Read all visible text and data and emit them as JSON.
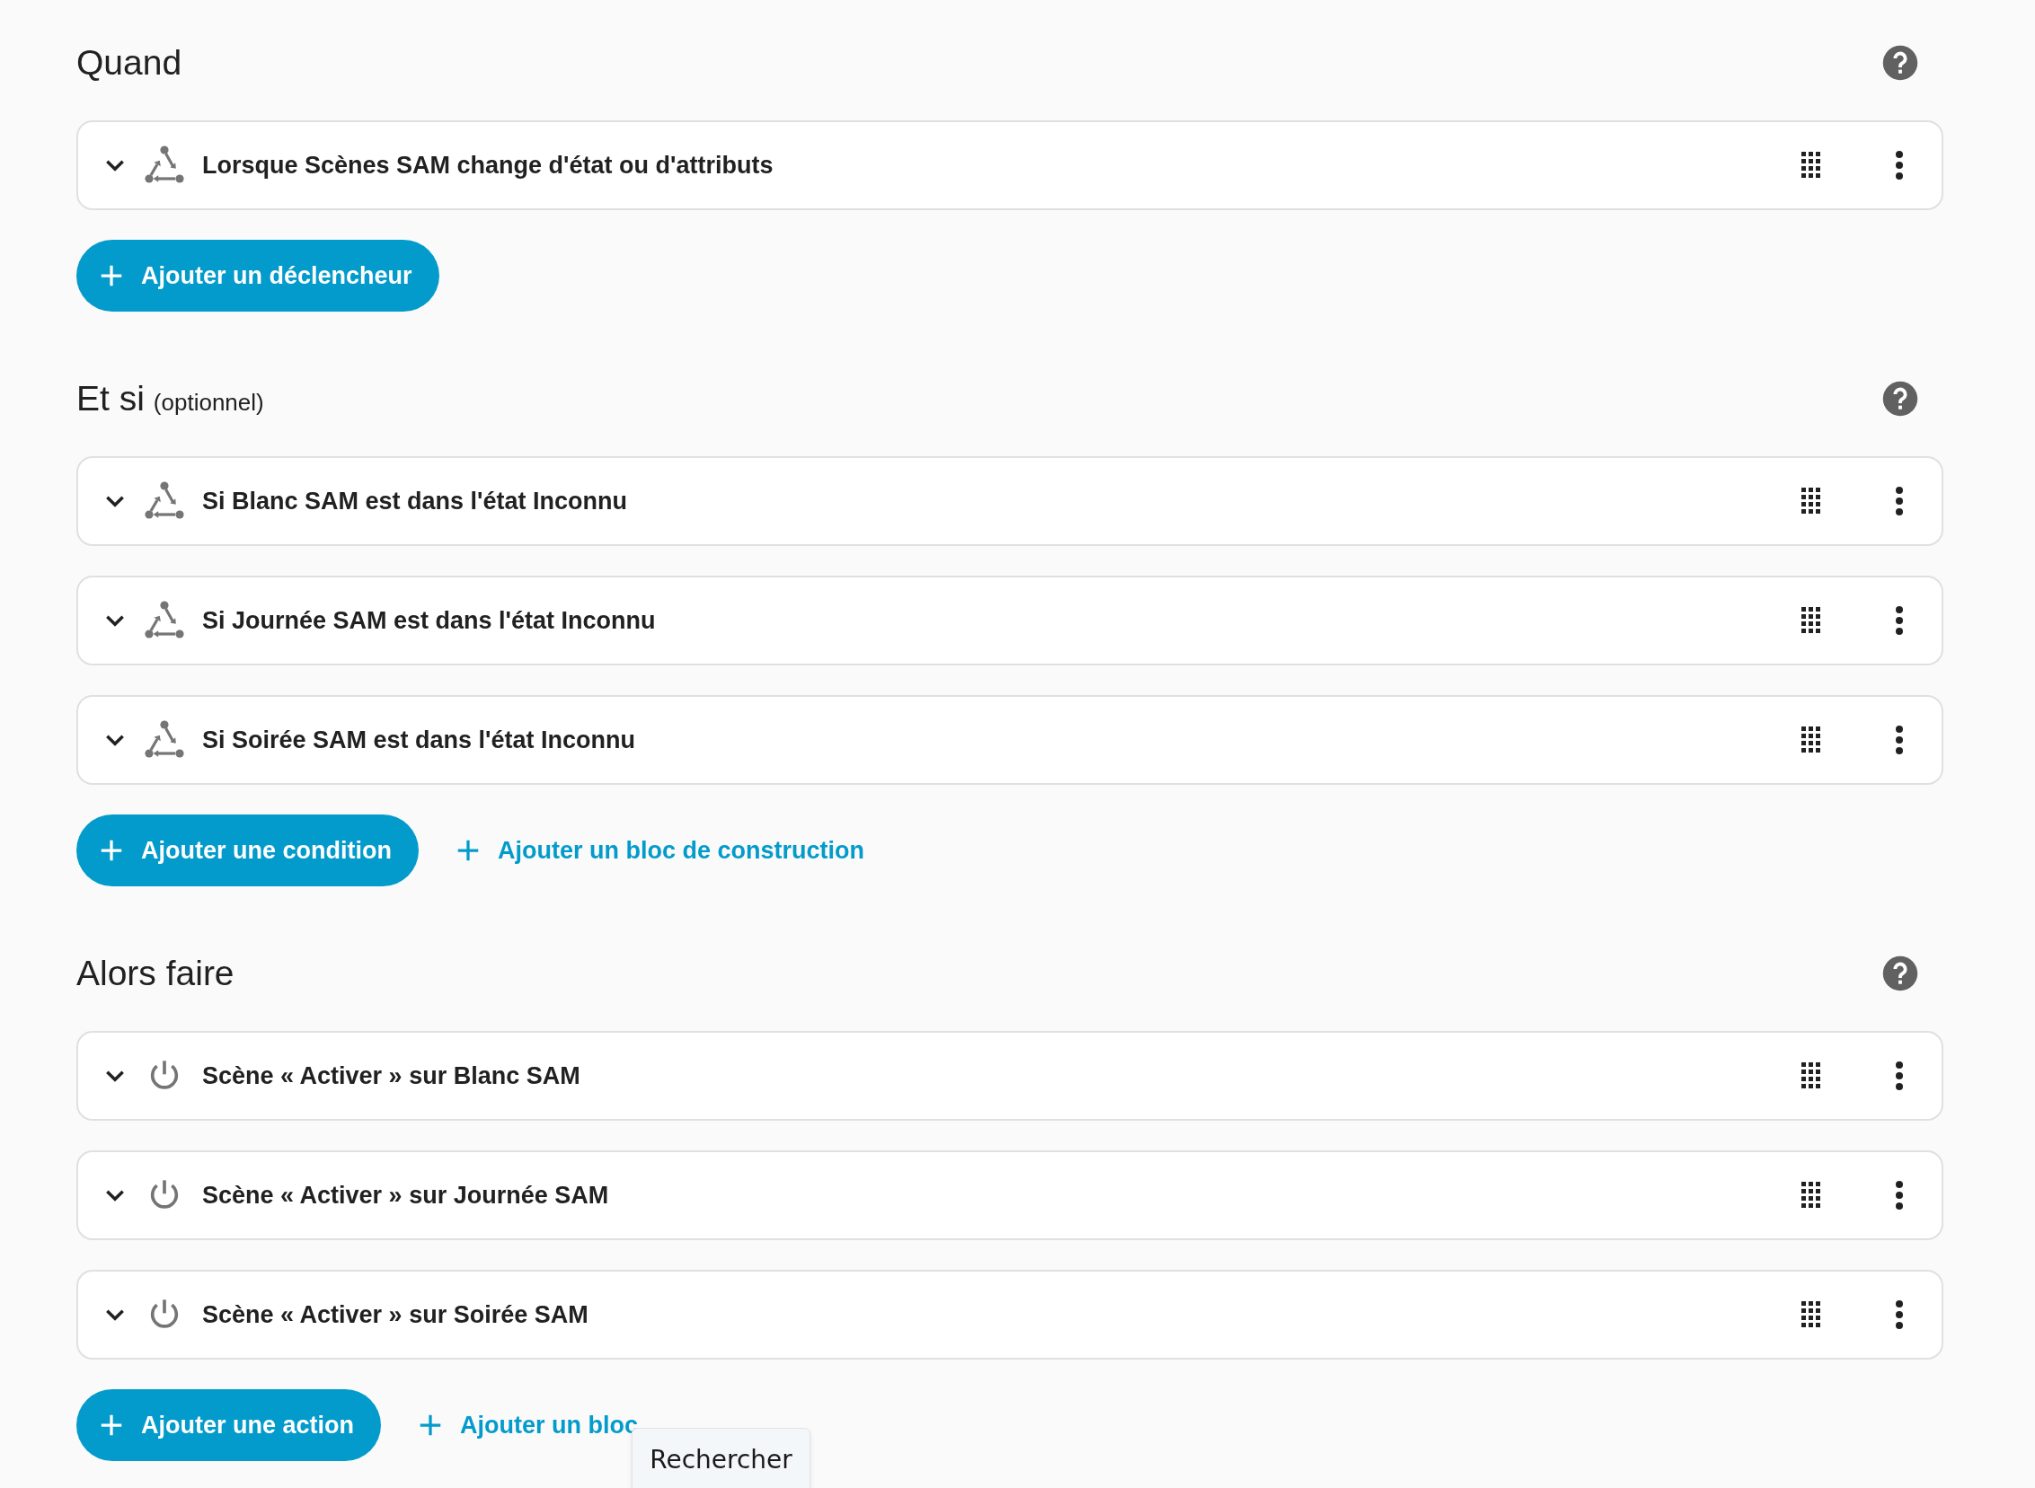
{
  "sections": [
    {
      "title": "Quand",
      "items": [
        {
          "kind": "device",
          "text": "Lorsque Scènes SAM change d'état ou d'attributs"
        }
      ],
      "buttons": [
        {
          "kind": "filled",
          "label": "Ajouter un déclencheur"
        }
      ]
    },
    {
      "title": "Et si",
      "subtitle": "(optionnel)",
      "items": [
        {
          "kind": "device",
          "text": "Si Blanc SAM est dans l'état Inconnu"
        },
        {
          "kind": "device",
          "text": "Si Journée SAM est dans l'état Inconnu"
        },
        {
          "kind": "device",
          "text": "Si Soirée SAM est dans l'état Inconnu"
        }
      ],
      "buttons": [
        {
          "kind": "filled",
          "label": "Ajouter une condition"
        },
        {
          "kind": "link",
          "label": "Ajouter un bloc de construction"
        }
      ]
    },
    {
      "title": "Alors faire",
      "items": [
        {
          "kind": "power",
          "text": "Scène « Activer » sur Blanc SAM"
        },
        {
          "kind": "power",
          "text": "Scène « Activer » sur Journée SAM"
        },
        {
          "kind": "power",
          "text": "Scène « Activer » sur Soirée SAM"
        }
      ],
      "buttons": [
        {
          "kind": "filled",
          "label": "Ajouter une action"
        },
        {
          "kind": "link",
          "label": "Ajouter un bloc"
        }
      ]
    }
  ],
  "tooltip": {
    "text": "Rechercher"
  }
}
